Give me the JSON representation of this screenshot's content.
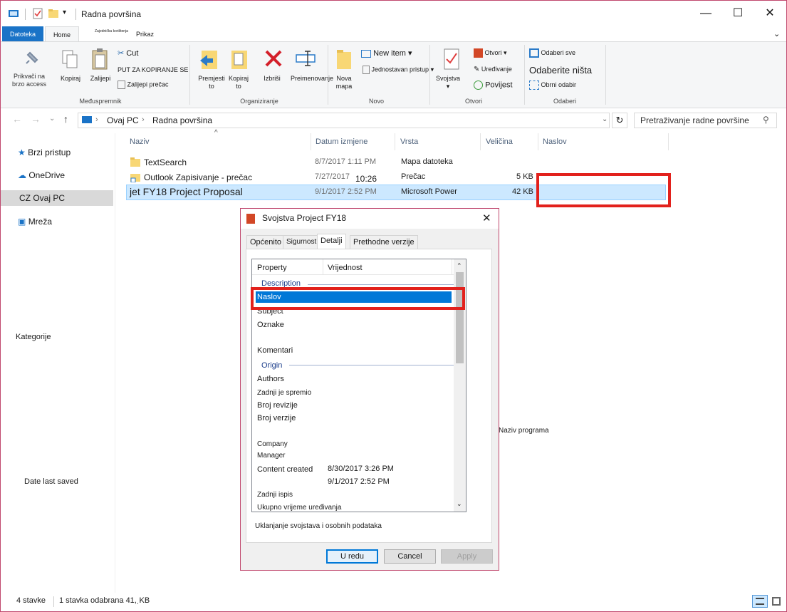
{
  "window": {
    "title": "Radna površina",
    "controls": {
      "minimize": "—",
      "maximize": "☐",
      "close": "✕"
    }
  },
  "ribbon_tabs": {
    "file": "Datoteka",
    "home": "Home",
    "share": "Zajednička korištenja",
    "view": "Prikaz"
  },
  "ribbon": {
    "pin": "Prikvači na brzo access",
    "copy": "Kopiraj",
    "paste": "Zalijepi",
    "cut": "Cut",
    "copy_path": "PUT ZA KOPIRANJE SE",
    "paste_shortcut": "Zalijepi prečac",
    "group_clipboard": "Međuspremnik",
    "move_to": "Premjesti to",
    "copy_to": "Kopiraj to",
    "delete": "Izbriši",
    "rename": "Preimenovanje",
    "group_organize": "Organiziranje",
    "new_folder": "Nova mapa",
    "new_item": "New item",
    "easy_access": "Jednostavan pristup",
    "group_new": "Novo",
    "properties": "Svojstva",
    "open": "Otvori",
    "edit": "Uređivanje",
    "history": "Povijest",
    "group_open": "Otvori",
    "select_all": "Odaberi sve",
    "select_none": "Odaberite ništa",
    "invert": "Obrni odabir",
    "group_select": "Odaberi"
  },
  "address": {
    "root": "Ovaj PC",
    "folder": "Radna površina",
    "search_placeholder": "Pretraživanje radne površine"
  },
  "nav": {
    "quick": "Brzi pristup",
    "onedrive": "OneDrive",
    "thispc": "CZ Ovaj PC",
    "network": "Mreža"
  },
  "stray": {
    "categories": "Kategorije",
    "date_saved": "Date last saved",
    "program_name": "Naziv programa"
  },
  "columns": {
    "name": "Naziv",
    "date": "Datum izmjene",
    "type": "Vrsta",
    "size": "Veličina",
    "title": "Naslov"
  },
  "files": [
    {
      "name": "TextSearch",
      "date": "8/7/2017 1:11 PM",
      "type": "Mapa datoteka",
      "size": ""
    },
    {
      "name": "Outlook Zapisivanje - prečac",
      "date": "7/27/2017",
      "time": "10:26",
      "type": "Prečac",
      "size": "5 KB"
    },
    {
      "name": "jet FY18 Project Proposal",
      "date": "9/1/2017 2:52 PM",
      "type": "Microsoft Power",
      "size": "42 KB"
    }
  ],
  "dialog": {
    "title": "Svojstva Project FY18",
    "tabs": [
      "Općenito",
      "Sigurnost",
      "Detalji",
      "Prethodne verzije"
    ],
    "col_property": "Property",
    "col_value": "Vrijednost",
    "sections": {
      "description": "Description",
      "origin": "Origin"
    },
    "props": {
      "title": "Naslov",
      "subject": "Subject",
      "tags": "Oznake",
      "comments": "Komentari",
      "authors": "Authors",
      "saved_by": "Zadnji je spremio",
      "revision": "Broj revizije",
      "version": "Broj verzije",
      "company": "Company",
      "manager": "Manager",
      "created": "Content created",
      "created_val": "8/30/2017 3:26 PM",
      "saved_val": "9/1/2017 2:52 PM",
      "printed": "Zadnji ispis",
      "edit_time": "Ukupno vrijeme uređivanja"
    },
    "remove_link": "Uklanjanje svojstava i osobnih podataka",
    "ok": "U redu",
    "cancel": "Cancel",
    "apply": "Apply"
  },
  "status": {
    "items": "4 stavke",
    "selected": "1 stavka odabrana 41,ˌKB"
  }
}
